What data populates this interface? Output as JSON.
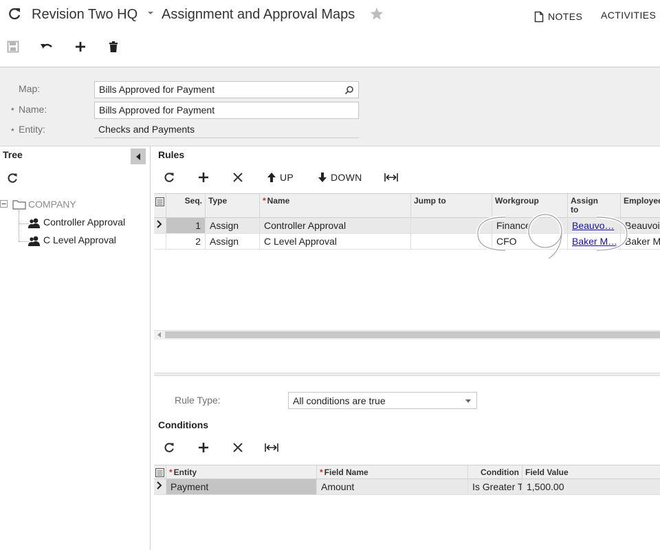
{
  "header": {
    "company": "Revision Two HQ",
    "screen_title": "Assignment and Approval Maps",
    "notes_label": "NOTES",
    "activities_label": "ACTIVITIES"
  },
  "form": {
    "map_label": "Map:",
    "map_value": "Bills Approved for Payment",
    "name_label": "Name:",
    "name_value": "Bills Approved for Payment",
    "entity_label": "Entity:",
    "entity_value": "Checks and Payments",
    "required_mark": "*"
  },
  "tree": {
    "title": "Tree",
    "root": "COMPANY",
    "items": [
      "Controller Approval",
      "C Level Approval"
    ]
  },
  "rules": {
    "title": "Rules",
    "up_label": "UP",
    "down_label": "DOWN",
    "columns": [
      "Seq.",
      "Type",
      "Name",
      "Jump to",
      "Workgroup",
      "Assign to",
      "Employee"
    ],
    "assign_to_line1": "Assign",
    "assign_to_line2": "to",
    "rows": [
      {
        "seq": "1",
        "type": "Assign",
        "name": "Controller Approval",
        "jump_to": "",
        "workgroup": "Finance",
        "assign_to": "Beauvo…",
        "employee": "Beauvoi"
      },
      {
        "seq": "2",
        "type": "Assign",
        "name": "C Level Approval",
        "jump_to": "",
        "workgroup": "CFO",
        "assign_to": "Baker M…",
        "employee": "Baker M"
      }
    ]
  },
  "rule_type": {
    "label": "Rule Type:",
    "value": "All conditions are true"
  },
  "conditions": {
    "title": "Conditions",
    "columns": [
      "Entity",
      "Field Name",
      "Condition",
      "Field Value"
    ],
    "rows": [
      {
        "entity": "Payment",
        "field_name": "Amount",
        "condition": "Is Greater T",
        "field_value": "1,500.00"
      }
    ]
  },
  "colors": {
    "accent_required": "#d9272e",
    "link": "#1a0dab",
    "selected_cell": "#c4c4c4"
  }
}
